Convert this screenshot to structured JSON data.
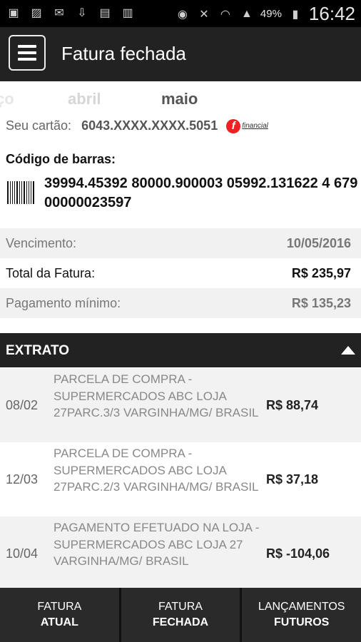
{
  "status_bar": {
    "time": "16:42",
    "battery": "49%",
    "icons": [
      "sim-icon",
      "image-icon",
      "gmail-icon",
      "download-icon",
      "bag-icon",
      "camera-bag-icon",
      "eye-icon",
      "mute-icon",
      "wifi-icon",
      "signal-icon",
      "battery-icon"
    ]
  },
  "app_bar": {
    "title": "Fatura fechada"
  },
  "months": {
    "prev2": "ço",
    "prev": "abril",
    "current": "maio"
  },
  "card": {
    "label": "Seu cartão:",
    "number": "6043.XXXX.XXXX.5051",
    "logo_text": "financial"
  },
  "barcode": {
    "label": "Código de barras:",
    "code": "39994.45392 80000.900003 05992.131622 4 67900000023597"
  },
  "summary": [
    {
      "label": "Vencimento:",
      "value": "10/05/2016"
    },
    {
      "label": "Total da Fatura:",
      "value": "R$ 235,97"
    },
    {
      "label": "Pagamento mínimo:",
      "value": "R$ 135,23"
    }
  ],
  "extrato": {
    "title": "EXTRATO",
    "items": [
      {
        "date": "08/02",
        "desc": "PARCELA DE COMPRA - SUPERMERCADOS ABC LOJA 27PARC.3/3 VARGINHA/MG/ BRASIL",
        "value": "R$ 88,74"
      },
      {
        "date": "12/03",
        "desc": "PARCELA DE COMPRA - SUPERMERCADOS ABC LOJA 27PARC.2/3 VARGINHA/MG/ BRASIL",
        "value": "R$ 37,18"
      },
      {
        "date": "10/04",
        "desc": "PAGAMENTO EFETUADO NA LOJA - SUPERMERCADOS ABC LOJA 27 VARGINHA/MG/ BRASIL",
        "value": "R$ -104,06"
      }
    ]
  },
  "bottom_nav": [
    {
      "line1": "FATURA",
      "line2": "ATUAL"
    },
    {
      "line1": "FATURA",
      "line2": "FECHADA"
    },
    {
      "line1": "LANÇAMENTOS",
      "line2": "FUTUROS"
    }
  ]
}
